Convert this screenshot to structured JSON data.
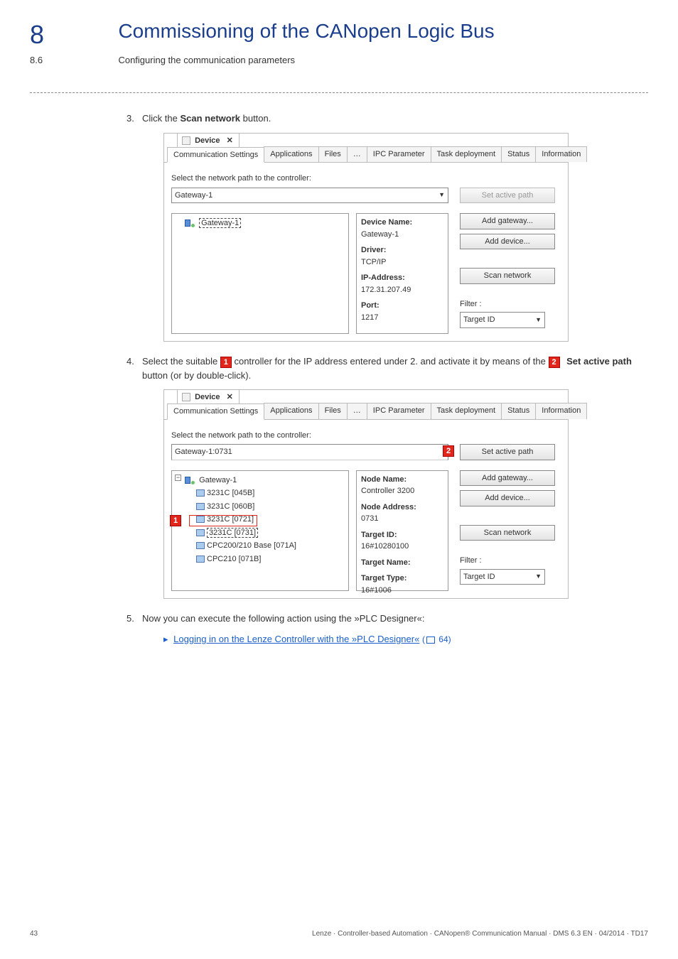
{
  "header": {
    "chapter_num": "8",
    "chapter_title": "Commissioning of the CANopen Logic Bus",
    "section_num": "8.6",
    "section_title": "Configuring the communication parameters"
  },
  "steps": {
    "s3_num": "3.",
    "s3_text_a": "Click the ",
    "s3_text_b": "Scan network",
    "s3_text_c": " button.",
    "s4_num": "4.",
    "s4_text_a": "Select the suitable ",
    "s4_text_b": " controller for the IP address entered under 2. and activate it by means of the ",
    "s4_text_c": "Set active path",
    "s4_text_d": " button (or by double-click).",
    "s5_num": "5.",
    "s5_text": "Now you can execute the following action using the »PLC Designer«:"
  },
  "callouts": {
    "c1": "1",
    "c2": "2"
  },
  "sc1": {
    "device_tab": "Device",
    "close": "✕",
    "tabs": {
      "comm": "Communication Settings",
      "apps": "Applications",
      "files": "Files",
      "dots": "…",
      "ipc": "IPC Parameter",
      "task": "Task deployment",
      "status": "Status",
      "info": "Information"
    },
    "select_label": "Select the network path to the controller:",
    "gateway_sel": "Gateway-1",
    "tree_root": "Gateway-1",
    "info": {
      "dn_l": "Device Name:",
      "dn_v": "Gateway-1",
      "drv_l": "Driver:",
      "drv_v": "TCP/IP",
      "ip_l": "IP-Address:",
      "ip_v": "172.31.207.49",
      "port_l": "Port:",
      "port_v": "1217"
    },
    "buttons": {
      "set_active": "Set active path",
      "add_gw": "Add gateway...",
      "add_dev": "Add device...",
      "scan": "Scan network"
    },
    "filter_label": "Filter :",
    "filter_value": "Target ID"
  },
  "sc2": {
    "device_tab": "Device",
    "close": "✕",
    "tabs": {
      "comm": "Communication Settings",
      "apps": "Applications",
      "files": "Files",
      "dots": "…",
      "ipc": "IPC Parameter",
      "task": "Task deployment",
      "status": "Status",
      "info": "Information"
    },
    "select_label": "Select the network path to the controller:",
    "gateway_sel": "Gateway-1:0731",
    "tree_root": "Gateway-1",
    "tree": {
      "n1": "3231C [045B]",
      "n2": "3231C [060B]",
      "n3": "3231C [0721]",
      "n4": "3231C [0731]",
      "n5": "CPC200/210 Base  [071A]",
      "n6": "CPC210 [071B]"
    },
    "info": {
      "nn_l": "Node Name:",
      "nn_v": "Controller 3200",
      "na_l": "Node Address:",
      "na_v": "0731",
      "tid_l": "Target ID:",
      "tid_v": "16#10280100",
      "tn_l": "Target Name:",
      "tt_l": "Target Type:",
      "tt_v": "16#1006"
    },
    "buttons": {
      "set_active": "Set active path",
      "add_gw": "Add gateway...",
      "add_dev": "Add device...",
      "scan": "Scan network"
    },
    "filter_label": "Filter :",
    "filter_value": "Target ID"
  },
  "link": {
    "text": "Logging in on the Lenze Controller with the »PLC Designer«",
    "page": "64"
  },
  "footer": {
    "page": "43",
    "meta": "Lenze · Controller-based Automation · CANopen® Communication Manual · DMS 6.3 EN · 04/2014 · TD17"
  }
}
